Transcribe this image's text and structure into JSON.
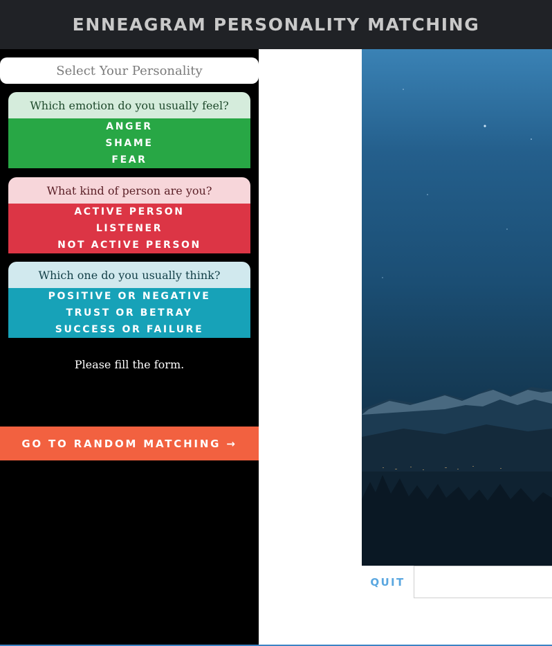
{
  "header": {
    "title": "ENNEAGRAM PERSONALITY MATCHING"
  },
  "sidebar": {
    "select_title": "Select Your Personality",
    "questions": [
      {
        "question": "Which emotion do you usually feel?",
        "options": [
          "ANGER",
          "SHAME",
          "FEAR"
        ],
        "color": "#28a745"
      },
      {
        "question": "What kind of person are you?",
        "options": [
          "ACTIVE PERSON",
          "LISTENER",
          "NOT ACTIVE PERSON"
        ],
        "color": "#dc3545"
      },
      {
        "question": "Which one do you usually think?",
        "options": [
          "POSITIVE OR NEGATIVE",
          "TRUST OR BETRAY",
          "SUCCESS OR FAILURE"
        ],
        "color": "#17a2b8"
      }
    ],
    "form_message": "Please fill the form.",
    "random_button": "GO TO RANDOM MATCHING →"
  },
  "main": {
    "photo": "night-mountain-lake",
    "quit_label": "QUIT",
    "message_input": {
      "value": "",
      "placeholder": ""
    }
  },
  "colors": {
    "header_bg": "#202226",
    "accent": "#f26140",
    "link": "#5aa7e0"
  }
}
